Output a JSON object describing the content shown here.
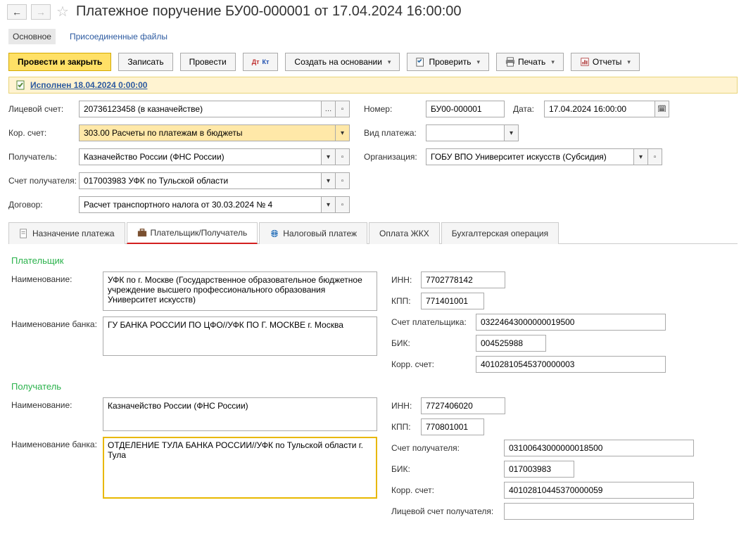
{
  "header": {
    "title": "Платежное поручение БУ00-000001 от 17.04.2024 16:00:00"
  },
  "navtabs": {
    "main": "Основное",
    "files": "Присоединенные файлы"
  },
  "commands": {
    "post_close": "Провести и закрыть",
    "save": "Записать",
    "post": "Провести",
    "create_based": "Создать на основании",
    "check": "Проверить",
    "print": "Печать",
    "reports": "Отчеты"
  },
  "status": {
    "text": "Исполнен 18.04.2024 0:00:00"
  },
  "labels": {
    "account": "Лицевой счет:",
    "cor_account": "Кор. счет:",
    "recipient": "Получатель:",
    "rec_account": "Счет получателя:",
    "contract": "Договор:",
    "number": "Номер:",
    "date": "Дата:",
    "payment_type": "Вид платежа:",
    "organization": "Организация:"
  },
  "fields": {
    "account": "20736123458 (в казначействе)",
    "cor_account": "303.00 Расчеты по платежам в бюджеты",
    "recipient": "Казначейство России (ФНС России)",
    "rec_account": "017003983 УФК по Тульской области",
    "contract": "Расчет транспортного налога от 30.03.2024 № 4",
    "number": "БУ00-000001",
    "date": "17.04.2024 16:00:00",
    "payment_type": "",
    "organization": "ГОБУ ВПО Университет искусств (Субсидия)"
  },
  "tabs": {
    "purpose": "Назначение платежа",
    "payer": "Плательщик/Получатель",
    "tax": "Налоговый платеж",
    "zkh": "Оплата ЖКХ",
    "accounting": "Бухгалтерская операция"
  },
  "payer_section": {
    "title": "Плательщик",
    "name_label": "Наименование:",
    "name": "УФК по г. Москве (Государственное образовательное бюджетное учреждение высшего профессионального образования Университет искусств)",
    "bank_label": "Наименование банка:",
    "bank": "ГУ БАНКА РОССИИ ПО ЦФО//УФК ПО Г. МОСКВЕ г. Москва",
    "inn_label": "ИНН:",
    "inn": "7702778142",
    "kpp_label": "КПП:",
    "kpp": "771401001",
    "acc_label": "Счет плательщика:",
    "acc": "03224643000000019500",
    "bik_label": "БИК:",
    "bik": "004525988",
    "korr_label": "Корр. счет:",
    "korr": "40102810545370000003"
  },
  "recipient_section": {
    "title": "Получатель",
    "name_label": "Наименование:",
    "name": "Казначейство России (ФНС России)",
    "bank_label": "Наименование банка:",
    "bank": "ОТДЕЛЕНИЕ ТУЛА БАНКА РОССИИ//УФК по Тульской области г. Тула",
    "inn_label": "ИНН:",
    "inn": "7727406020",
    "kpp_label": "КПП:",
    "kpp": "770801001",
    "acc_label": "Счет получателя:",
    "acc": "03100643000000018500",
    "bik_label": "БИК:",
    "bik": "017003983",
    "korr_label": "Корр. счет:",
    "korr": "40102810445370000059",
    "lic_label": "Лицевой счет получателя:",
    "lic": ""
  }
}
